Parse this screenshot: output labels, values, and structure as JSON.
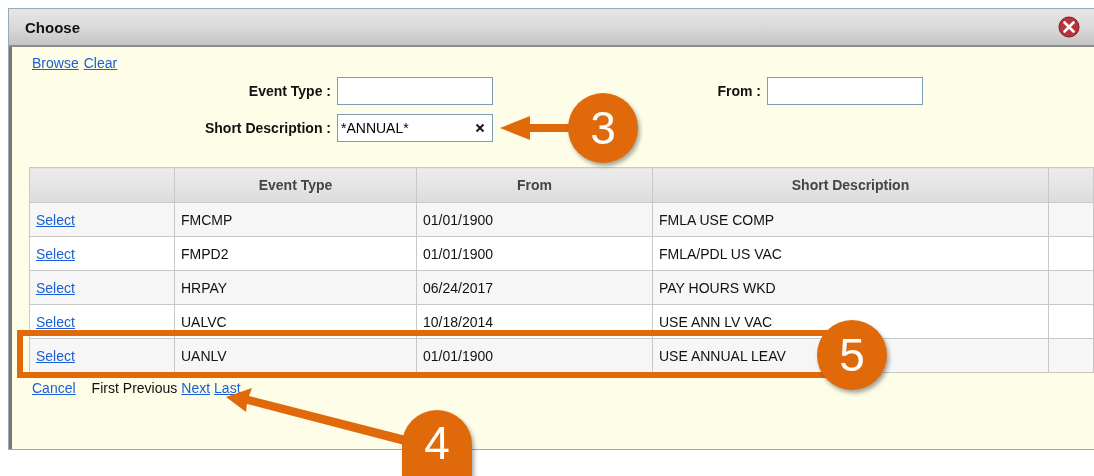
{
  "window": {
    "title": "Choose"
  },
  "links": [
    "Browse",
    "Clear"
  ],
  "filters": [
    {
      "label": "Event Type :"
    },
    {
      "label": "Short Description :",
      "value": "*ANNUAL*"
    },
    {
      "label": "From :"
    }
  ],
  "table": {
    "columns": [
      "",
      "Event Type",
      "From",
      "Short Description",
      ""
    ],
    "rows": [
      {
        "action": "Select",
        "event_type": "FMCMP",
        "from": "01/01/1900",
        "short_description": "FMLA USE COMP"
      },
      {
        "action": "Select",
        "event_type": "FMPD2",
        "from": "01/01/1900",
        "short_description": "FMLA/PDL US VAC"
      },
      {
        "action": "Select",
        "event_type": "HRPAY",
        "from": "06/24/2017",
        "short_description": "PAY HOURS WKD"
      },
      {
        "action": "Select",
        "event_type": "UALVC",
        "from": "10/18/2014",
        "short_description": "USE ANN LV VAC"
      },
      {
        "action": "Select",
        "event_type": "UANLV",
        "from": "01/01/1900",
        "short_description": "USE ANNUAL LEAV"
      }
    ]
  },
  "footer": {
    "cancel": "Cancel",
    "pager": [
      {
        "label": "First",
        "disabled": true
      },
      {
        "label": "Previous",
        "disabled": true
      },
      {
        "label": "Next",
        "disabled": false
      },
      {
        "label": "Last",
        "disabled": false
      }
    ]
  },
  "annotations": [
    {
      "label": "3"
    },
    {
      "label": "5"
    },
    {
      "label": "4"
    }
  ]
}
